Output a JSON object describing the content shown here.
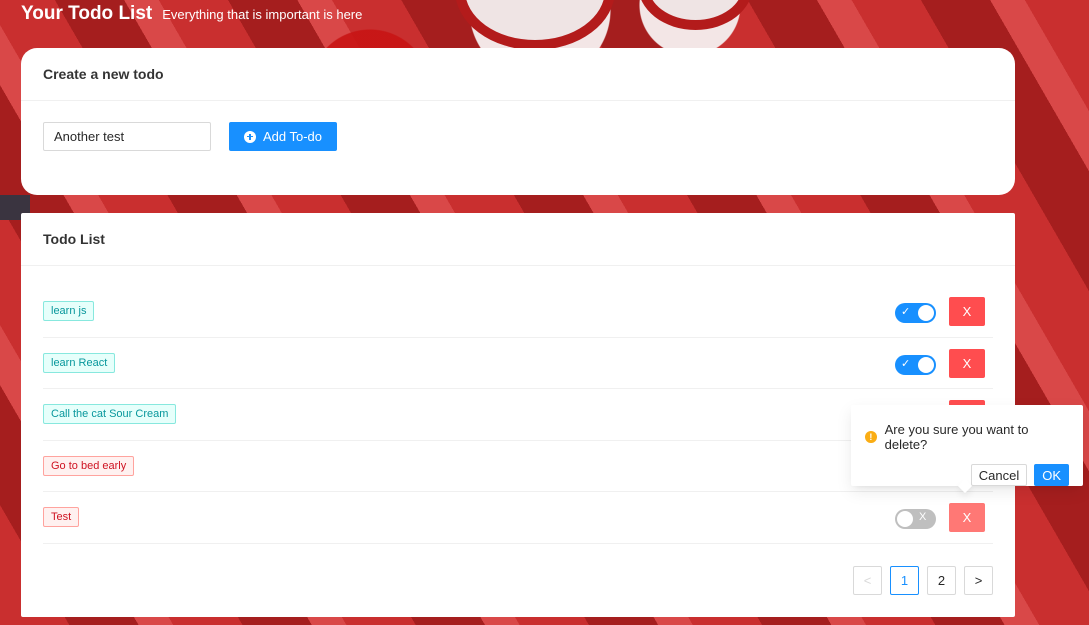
{
  "header": {
    "title": "Your Todo List",
    "subtitle": "Everything that is important is here"
  },
  "create": {
    "title": "Create a new todo",
    "input_value": "Another test",
    "add_label": "Add To-do"
  },
  "list": {
    "title": "Todo List",
    "items": [
      {
        "label": "learn js",
        "color": "cyan",
        "done": true
      },
      {
        "label": "learn React",
        "color": "cyan",
        "done": true
      },
      {
        "label": "Call the cat Sour Cream",
        "color": "cyan",
        "done": true
      },
      {
        "label": "Go to bed early",
        "color": "red",
        "done": false
      },
      {
        "label": "Test",
        "color": "red",
        "done": false
      }
    ],
    "delete_label": "X",
    "switch_on_mark": "✓",
    "switch_off_mark": "X"
  },
  "pagination": {
    "prev": "<",
    "pages": [
      "1",
      "2"
    ],
    "current": "1",
    "next": ">"
  },
  "popconfirm": {
    "message": "Are you sure you want to delete?",
    "cancel": "Cancel",
    "ok": "OK"
  },
  "colors": {
    "primary": "#1890ff",
    "danger": "#ff4d4f",
    "warning": "#faad14",
    "tag_cyan": "#08979c",
    "tag_red": "#cf1322"
  }
}
